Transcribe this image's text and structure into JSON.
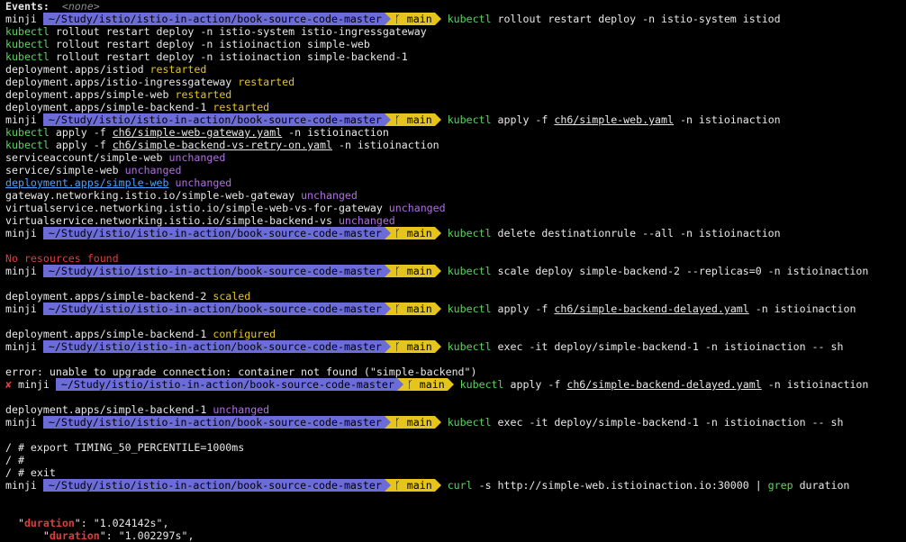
{
  "events": {
    "label": "Events:",
    "value": "<none>"
  },
  "prompt": {
    "user": "minji",
    "path_full": "~/Study/istio/istio-in-action/book-source-code-master",
    "branch": "main",
    "branch_icon": "git-branch-icon",
    "error_mark": "✘"
  },
  "colors": {
    "path_bg": "#6c6cd8",
    "branch_bg": "#e5c41b",
    "green": "#5fd35f",
    "yellow": "#e5c41b",
    "purple": "#b16ee8",
    "red": "#e03c3c",
    "link": "#4aa3ff"
  },
  "lines": [
    {
      "type": "plain",
      "parts": [
        {
          "t": "Events:",
          "c": "white bold"
        },
        {
          "t": "  <none>",
          "c": "dim"
        }
      ]
    },
    {
      "type": "prompt",
      "cmd": [
        {
          "t": "kubectl",
          "c": "green"
        },
        {
          "t": " rollout restart deploy -n istio-system istiod",
          "c": "white"
        }
      ]
    },
    {
      "type": "plain",
      "parts": [
        {
          "t": "kubectl",
          "c": "green"
        },
        {
          "t": " rollout restart deploy -n istio-system istio-ingressgateway",
          "c": "white"
        }
      ]
    },
    {
      "type": "plain",
      "parts": [
        {
          "t": "kubectl",
          "c": "green"
        },
        {
          "t": " rollout restart deploy -n istioinaction simple-web",
          "c": "white"
        }
      ]
    },
    {
      "type": "plain",
      "parts": [
        {
          "t": "kubectl",
          "c": "green"
        },
        {
          "t": " rollout restart deploy -n istioinaction simple-backend-1",
          "c": "white"
        }
      ]
    },
    {
      "type": "plain",
      "parts": [
        {
          "t": "deployment.apps/istiod ",
          "c": "white"
        },
        {
          "t": "restarted",
          "c": "yellow"
        }
      ]
    },
    {
      "type": "plain",
      "parts": [
        {
          "t": "deployment.apps/istio-ingressgateway ",
          "c": "white"
        },
        {
          "t": "restarted",
          "c": "yellow"
        }
      ]
    },
    {
      "type": "plain",
      "parts": [
        {
          "t": "deployment.apps/simple-web ",
          "c": "white"
        },
        {
          "t": "restarted",
          "c": "yellow"
        }
      ]
    },
    {
      "type": "plain",
      "parts": [
        {
          "t": "deployment.apps/simple-backend-1 ",
          "c": "white"
        },
        {
          "t": "restarted",
          "c": "yellow"
        }
      ]
    },
    {
      "type": "prompt",
      "cmd": [
        {
          "t": "kubectl",
          "c": "green"
        },
        {
          "t": " apply -f ",
          "c": "white"
        },
        {
          "t": "ch6/simple-web.yaml",
          "c": "white ul"
        },
        {
          "t": " -n istioinaction",
          "c": "white"
        }
      ]
    },
    {
      "type": "plain",
      "parts": [
        {
          "t": "kubectl",
          "c": "green"
        },
        {
          "t": " apply -f ",
          "c": "white"
        },
        {
          "t": "ch6/simple-web-gateway.yaml",
          "c": "white ul"
        },
        {
          "t": " -n istioinaction",
          "c": "white"
        }
      ]
    },
    {
      "type": "plain",
      "parts": [
        {
          "t": "kubectl",
          "c": "green"
        },
        {
          "t": " apply -f ",
          "c": "white"
        },
        {
          "t": "ch6/simple-backend-vs-retry-on.yaml",
          "c": "white ul"
        },
        {
          "t": " -n istioinaction",
          "c": "white"
        }
      ]
    },
    {
      "type": "plain",
      "parts": [
        {
          "t": "serviceaccount/simple-web ",
          "c": "white"
        },
        {
          "t": "unchanged",
          "c": "purple"
        }
      ]
    },
    {
      "type": "plain",
      "parts": [
        {
          "t": "service/simple-web ",
          "c": "white"
        },
        {
          "t": "unchanged",
          "c": "purple"
        }
      ]
    },
    {
      "type": "plain",
      "parts": [
        {
          "t": "deployment.apps/simple-web",
          "c": "blue ul"
        },
        {
          "t": " ",
          "c": "white"
        },
        {
          "t": "unchanged",
          "c": "purple"
        }
      ]
    },
    {
      "type": "plain",
      "parts": [
        {
          "t": "gateway.networking.istio.io/simple-web-gateway ",
          "c": "white"
        },
        {
          "t": "unchanged",
          "c": "purple"
        }
      ]
    },
    {
      "type": "plain",
      "parts": [
        {
          "t": "virtualservice.networking.istio.io/simple-web-vs-for-gateway ",
          "c": "white"
        },
        {
          "t": "unchanged",
          "c": "purple"
        }
      ]
    },
    {
      "type": "plain",
      "parts": [
        {
          "t": "virtualservice.networking.istio.io/simple-backend-vs ",
          "c": "white"
        },
        {
          "t": "unchanged",
          "c": "purple"
        }
      ]
    },
    {
      "type": "prompt",
      "cmd": [
        {
          "t": "kubectl",
          "c": "green"
        },
        {
          "t": " delete destinationrule --all -n istioinaction",
          "c": "white"
        }
      ]
    },
    {
      "type": "plain",
      "parts": [
        {
          "t": "",
          "c": "white"
        }
      ]
    },
    {
      "type": "plain",
      "parts": [
        {
          "t": "No resources found",
          "c": "red"
        }
      ]
    },
    {
      "type": "prompt",
      "cmd": [
        {
          "t": "kubectl",
          "c": "green"
        },
        {
          "t": " scale deploy simple-backend-2 --replicas=0 -n istioinaction",
          "c": "white"
        }
      ]
    },
    {
      "type": "plain",
      "parts": [
        {
          "t": "",
          "c": "white"
        }
      ]
    },
    {
      "type": "plain",
      "parts": [
        {
          "t": "deployment.apps/simple-backend-2 ",
          "c": "white"
        },
        {
          "t": "scaled",
          "c": "yellow"
        }
      ]
    },
    {
      "type": "prompt",
      "cmd": [
        {
          "t": "kubectl",
          "c": "green"
        },
        {
          "t": " apply -f ",
          "c": "white"
        },
        {
          "t": "ch6/simple-backend-delayed.yaml",
          "c": "white ul"
        },
        {
          "t": " -n istioinaction",
          "c": "white"
        }
      ]
    },
    {
      "type": "plain",
      "parts": [
        {
          "t": "",
          "c": "white"
        }
      ]
    },
    {
      "type": "plain",
      "parts": [
        {
          "t": "deployment.apps/simple-backend-1 ",
          "c": "white"
        },
        {
          "t": "configured",
          "c": "yellow"
        }
      ]
    },
    {
      "type": "prompt",
      "cmd": [
        {
          "t": "kubectl",
          "c": "green"
        },
        {
          "t": " exec -it deploy/simple-backend-1 -n istioinaction -- sh",
          "c": "white"
        }
      ]
    },
    {
      "type": "plain",
      "parts": [
        {
          "t": "",
          "c": "white"
        }
      ]
    },
    {
      "type": "plain",
      "parts": [
        {
          "t": "error: unable to upgrade connection: container not found (\"simple-backend\")",
          "c": "white"
        }
      ]
    },
    {
      "type": "prompt",
      "error": true,
      "cmd": [
        {
          "t": "kubectl",
          "c": "green"
        },
        {
          "t": " apply -f ",
          "c": "white"
        },
        {
          "t": "ch6/simple-backend-delayed.yaml",
          "c": "white ul"
        },
        {
          "t": " -n istioinaction",
          "c": "white"
        }
      ]
    },
    {
      "type": "plain",
      "parts": [
        {
          "t": "",
          "c": "white"
        }
      ]
    },
    {
      "type": "plain",
      "parts": [
        {
          "t": "deployment.apps/simple-backend-1 ",
          "c": "white"
        },
        {
          "t": "unchanged",
          "c": "purple"
        }
      ]
    },
    {
      "type": "prompt",
      "cmd": [
        {
          "t": "kubectl",
          "c": "green"
        },
        {
          "t": " exec -it deploy/simple-backend-1 -n istioinaction -- sh",
          "c": "white"
        }
      ]
    },
    {
      "type": "plain",
      "parts": [
        {
          "t": "",
          "c": "white"
        }
      ]
    },
    {
      "type": "plain",
      "parts": [
        {
          "t": "/ # export TIMING_50_PERCENTILE=1000ms",
          "c": "white"
        }
      ]
    },
    {
      "type": "plain",
      "parts": [
        {
          "t": "/ #",
          "c": "white"
        }
      ]
    },
    {
      "type": "plain",
      "parts": [
        {
          "t": "/ # exit",
          "c": "white"
        }
      ]
    },
    {
      "type": "prompt",
      "cmd": [
        {
          "t": "curl",
          "c": "green"
        },
        {
          "t": " -s http://simple-web.istioinaction.io:30000 | ",
          "c": "white"
        },
        {
          "t": "grep",
          "c": "green"
        },
        {
          "t": " duration",
          "c": "white"
        }
      ]
    },
    {
      "type": "plain",
      "parts": [
        {
          "t": "",
          "c": "white"
        }
      ]
    },
    {
      "type": "plain",
      "parts": [
        {
          "t": "",
          "c": "white"
        }
      ]
    },
    {
      "type": "plain",
      "parts": [
        {
          "t": "  \"",
          "c": "white"
        },
        {
          "t": "duration",
          "c": "red bold"
        },
        {
          "t": "\": \"1.024142s\",",
          "c": "white"
        }
      ]
    },
    {
      "type": "plain",
      "parts": [
        {
          "t": "      \"",
          "c": "white"
        },
        {
          "t": "duration",
          "c": "red bold"
        },
        {
          "t": "\": \"1.002297s\",",
          "c": "white"
        }
      ]
    }
  ]
}
